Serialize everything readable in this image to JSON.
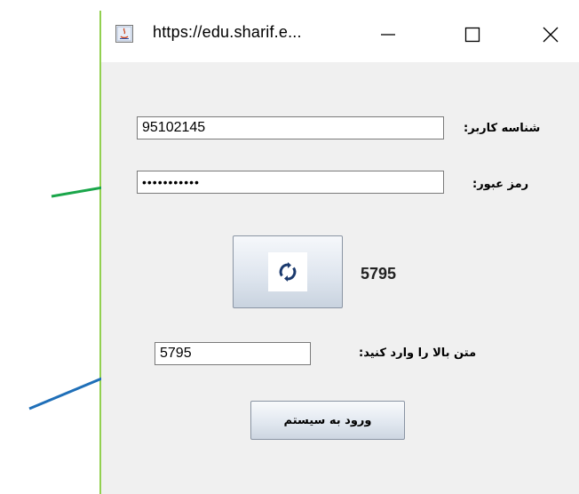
{
  "window": {
    "title": "https://edu.sharif.e...",
    "controls": {
      "minimize": "—",
      "maximize": "☐",
      "close": "✕"
    }
  },
  "form": {
    "username_label": "شناسه کاربر:",
    "username_value": "95102145",
    "password_label": "رمز عبور:",
    "password_mask": "•••••••••••",
    "captcha_value": "5795",
    "captcha_input_label": "متن بالا را وارد کنید:",
    "captcha_input_value": "5795",
    "login_button_label": "ورود به سیستم"
  },
  "colors": {
    "arrow_password": "#1aa64a",
    "arrow_refresh": "#e8201c",
    "arrow_captcha": "#1f6fb8",
    "side_rule": "#92d050",
    "refresh_icon": "#1b3a6e"
  }
}
